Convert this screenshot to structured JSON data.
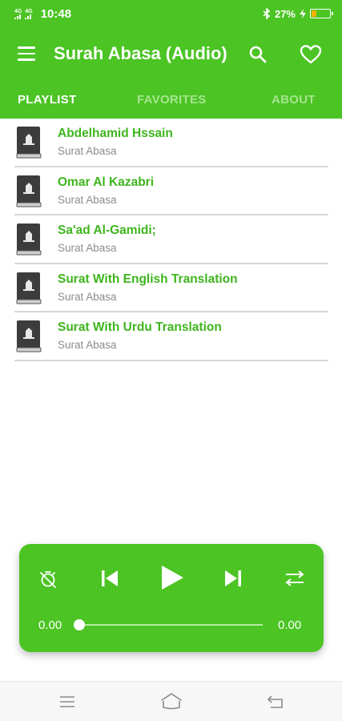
{
  "status_bar": {
    "network_1": "4G",
    "network_2": "4G",
    "time": "10:48",
    "battery_text": "27%",
    "battery_level": 0.27
  },
  "toolbar": {
    "title": "Surah Abasa (Audio)",
    "icons": [
      "menu-icon",
      "search-icon",
      "heart-icon"
    ]
  },
  "tabs": [
    {
      "label": "PLAYLIST",
      "active": true
    },
    {
      "label": "FAVORITES",
      "active": false
    },
    {
      "label": "ABOUT",
      "active": false
    }
  ],
  "playlist": [
    {
      "title": "Abdelhamid Hssain",
      "subtitle": "Surat Abasa"
    },
    {
      "title": "Omar Al Kazabri",
      "subtitle": "Surat Abasa"
    },
    {
      "title": "Sa'ad Al-Gamidi;",
      "subtitle": "Surat Abasa"
    },
    {
      "title": "Surat With English Translation",
      "subtitle": "Surat Abasa"
    },
    {
      "title": "Surat With Urdu Translation",
      "subtitle": "Surat Abasa"
    }
  ],
  "player": {
    "current_time": "0.00",
    "total_time": "0.00",
    "progress": 0,
    "icons": [
      "timer-off-icon",
      "skip-previous-icon",
      "play-icon",
      "skip-next-icon",
      "repeat-icon"
    ]
  },
  "colors": {
    "accent": "#4bc424",
    "item_title": "#3eb51d",
    "inactive_tab": "#a6e58f"
  }
}
